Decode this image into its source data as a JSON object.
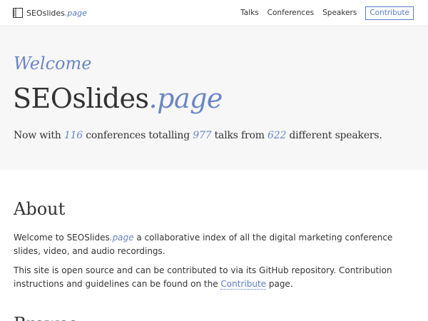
{
  "header": {
    "brand_name": "SEOslides",
    "brand_suffix": ".page",
    "brand_icon": "book-icon",
    "nav": {
      "talks": "Talks",
      "conferences": "Conferences",
      "speakers": "Speakers",
      "contribute": "Contribute"
    }
  },
  "hero": {
    "welcome": "Welcome",
    "title_main": "SEOslides",
    "title_suffix": ".page",
    "stats": {
      "prefix": "Now with ",
      "conferences": "116",
      "mid1": " conferences totalling ",
      "talks": "977",
      "mid2": " talks from ",
      "speakers": "622",
      "suffix": " different speakers."
    }
  },
  "about": {
    "heading": "About",
    "para1_prefix": "Welcome to SEOSlides",
    "para1_page": ".page",
    "para1_suffix": " a collaborative index of all the digital marketing conference slides, video, and audio recordings.",
    "para2_prefix": "This site is open source and can be contributed to via its GitHub repository. Contribution instructions and guidelines can be found on the ",
    "para2_link": "Contribute",
    "para2_suffix": " page."
  },
  "browse": {
    "heading": "Browse"
  },
  "colors": {
    "accent": "#6a86c8",
    "link": "#5a7bc4",
    "hero_bg": "#f7f7f7",
    "text": "#333333"
  }
}
